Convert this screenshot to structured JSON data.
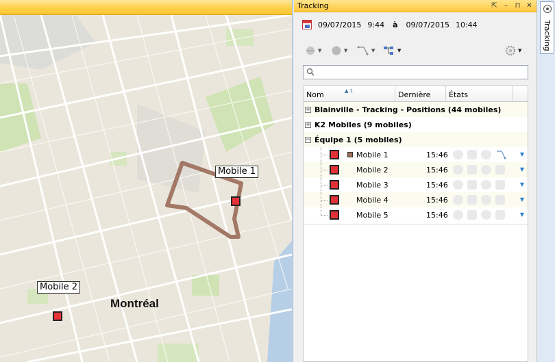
{
  "map": {
    "city_label": "Montréal",
    "markers": [
      {
        "label": "Mobile 1"
      },
      {
        "label": "Mobile 2"
      }
    ]
  },
  "panel": {
    "title": "Tracking",
    "date_range": {
      "start_date": "09/07/2015",
      "start_time": "9:44",
      "separator": "à",
      "end_date": "09/07/2015",
      "end_time": "10:44"
    },
    "search": {
      "placeholder": ""
    },
    "columns": {
      "name": "Nom",
      "last_seen": "Dernière fois",
      "states": "États",
      "sort_index": "1"
    },
    "groups": [
      {
        "label": "Blainville - Tracking - Positions (44 mobiles)",
        "expander": "+"
      },
      {
        "label": "K2 Mobiles (9 mobiles)",
        "expander": "+"
      },
      {
        "label": "Équipe 1 (5 mobiles)",
        "expander": "−"
      }
    ],
    "mobiles": [
      {
        "name": "Mobile 1",
        "time": "15:46"
      },
      {
        "name": "Mobile 2",
        "time": "15:46"
      },
      {
        "name": "Mobile 3",
        "time": "15:46"
      },
      {
        "name": "Mobile 4",
        "time": "15:46"
      },
      {
        "name": "Mobile 5",
        "time": "15:46"
      }
    ]
  },
  "side_tab": {
    "label": "Tracking"
  },
  "colors": {
    "accent_title": "#ffc93d",
    "marker": "#e23238",
    "trail": "#9b6b5a",
    "dropdown": "#2f7fd4"
  }
}
